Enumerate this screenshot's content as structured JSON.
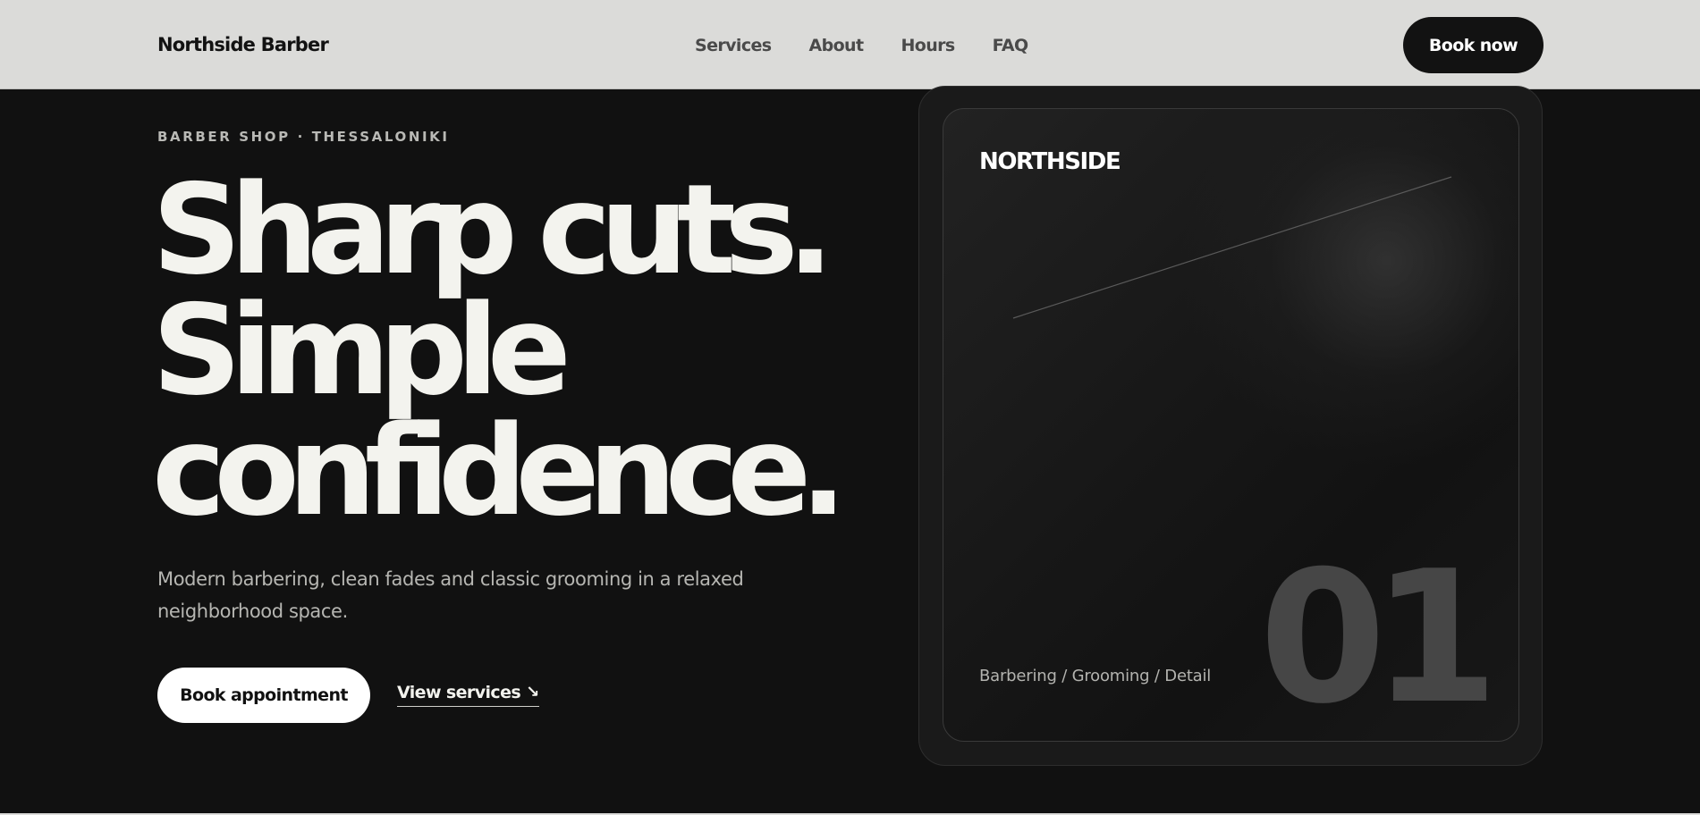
{
  "header": {
    "brand": "Northside Barber",
    "nav": [
      "Services",
      "About",
      "Hours",
      "FAQ"
    ],
    "cta": "Book now"
  },
  "hero": {
    "eyebrow": "BARBER SHOP · THESSALONIKI",
    "headline": [
      "Sharp cuts.",
      "Simple",
      "confidence."
    ],
    "lead": "Modern barbering, clean fades and classic grooming in a relaxed neighborhood space.",
    "primary_button": "Book appointment",
    "secondary_link": "View services",
    "secondary_link_icon": "arrow-down-right-icon"
  },
  "card": {
    "logo": "NORTHSIDE",
    "tagline": "Barbering / Grooming / Detail",
    "number": "01"
  },
  "colors": {
    "background": "#111111",
    "header_bg": "#dbdbd9",
    "headline": "#f3f3ee",
    "card_number": "#464646"
  }
}
